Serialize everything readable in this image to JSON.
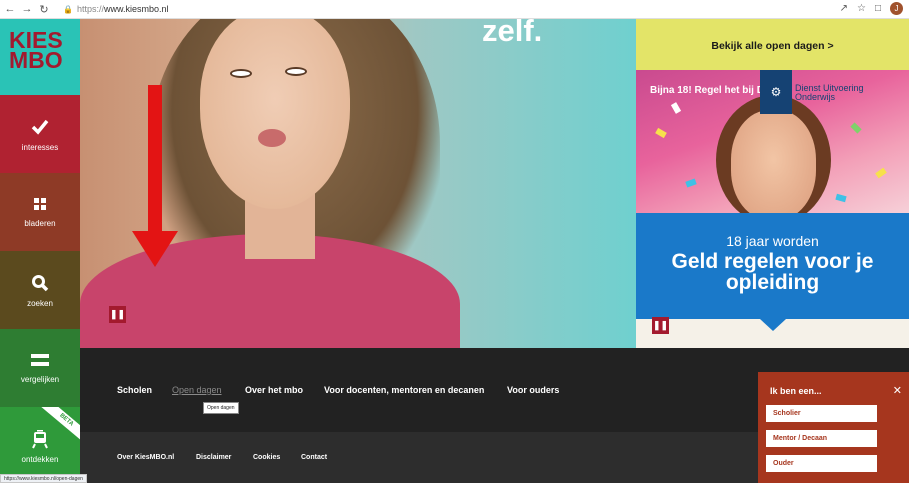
{
  "browser": {
    "url_scheme": "https://",
    "url_host": "www.kiesmbo.nl",
    "avatar_letter": "J"
  },
  "sidebar": {
    "logo": [
      "KIES",
      "MBO"
    ],
    "items": [
      {
        "label": "interesses",
        "icon": "checkmark-icon"
      },
      {
        "label": "bladeren",
        "icon": "grid-icon"
      },
      {
        "label": "zoeken",
        "icon": "search-icon"
      },
      {
        "label": "vergelijken",
        "icon": "equals-icon"
      },
      {
        "label": "ontdekken",
        "icon": "tram-icon",
        "badge": "BETA"
      }
    ]
  },
  "hero": {
    "text": "zelf."
  },
  "right": {
    "open_days": "Bekijk alle open dagen >",
    "promo_title": "Bijna 18! Regel het bij DUO",
    "duo_logo_text": [
      "Dienst Uitvoering",
      "Onderwijs"
    ],
    "promo_sub": "18 jaar worden",
    "promo_main": [
      "Geld regelen voor je",
      "opleiding"
    ]
  },
  "mainnav": {
    "items": [
      "Scholen",
      "Open dagen",
      "Over het mbo",
      "Voor docenten, mentoren en decanen",
      "Voor ouders"
    ],
    "active_index": 1,
    "tooltip": "Open dagen"
  },
  "footer": {
    "items": [
      "Over KiesMBO.nl",
      "Disclaimer",
      "Cookies",
      "Contact"
    ]
  },
  "status_url": "https://www.kiesmbo.nl/open-dagen",
  "role_panel": {
    "title": "Ik ben een...",
    "options": [
      "Scholier",
      "Mentor / Decaan",
      "Ouder"
    ]
  },
  "colors": {
    "logo_bg": "#2ac3b6",
    "brand_red": "#a31a2e",
    "opendays_bg": "#e3e468",
    "duo_blue": "#1a79c9",
    "role_bg": "#a6361e"
  }
}
